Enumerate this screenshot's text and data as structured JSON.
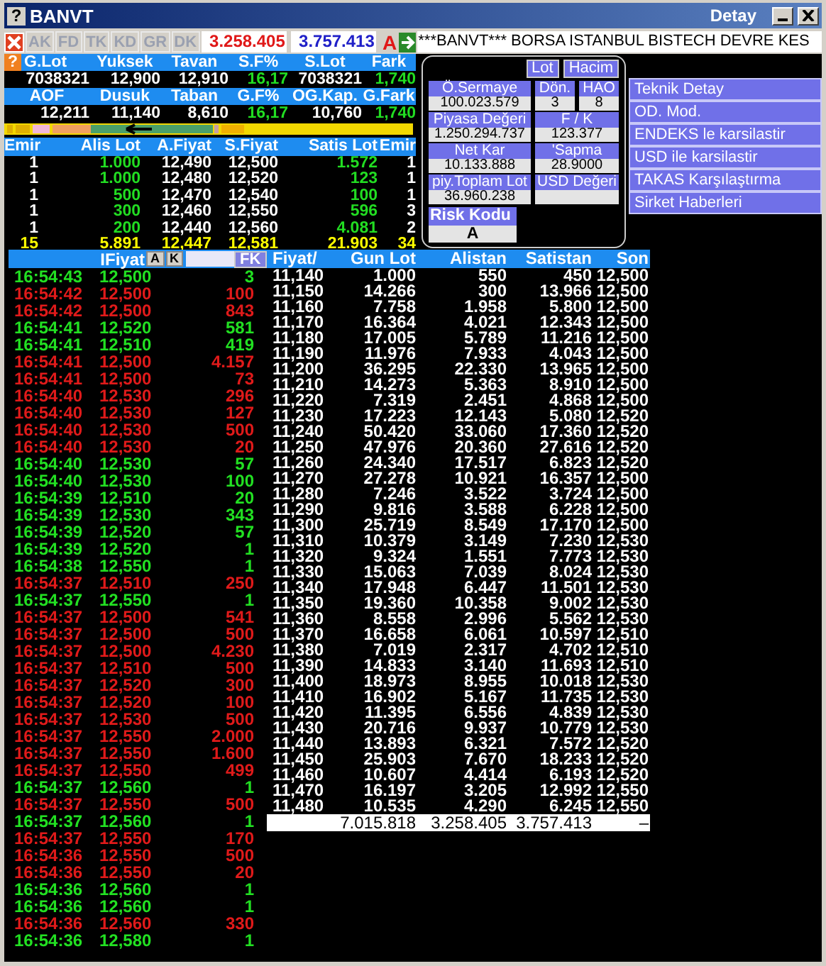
{
  "window": {
    "help": "?",
    "title": "BANVT",
    "detail_title": "Detay"
  },
  "toolbar": {
    "buttons": [
      {
        "label": "AK",
        "disabled": true
      },
      {
        "label": "FD",
        "disabled": true
      },
      {
        "label": "TK",
        "disabled": true
      },
      {
        "label": "KD",
        "disabled": true
      },
      {
        "label": "GR",
        "disabled": true
      },
      {
        "label": "DK",
        "disabled": true
      }
    ],
    "buy_total": "3.258.405",
    "sell_total": "3.757.413",
    "flag": "A"
  },
  "ticker": "***BANVT*** BORSA ISTANBUL BISTECH DEVRE KES",
  "summary": {
    "help": "?",
    "rows": [
      [
        {
          "label": "G.Lot",
          "value": "7038321",
          "positive": false
        },
        {
          "label": "Yuksek",
          "value": "12,900",
          "positive": false
        },
        {
          "label": "Tavan",
          "value": "12,910",
          "positive": false
        },
        {
          "label": "S.F%",
          "value": "16,17",
          "positive": true
        },
        {
          "label": "S.Lot",
          "value": "7038321",
          "positive": false
        },
        {
          "label": "Fark",
          "value": "1,740",
          "positive": true
        }
      ],
      [
        {
          "label": "AOF",
          "value": "12,211",
          "positive": false
        },
        {
          "label": "Dusuk",
          "value": "11,140",
          "positive": false
        },
        {
          "label": "Taban",
          "value": "8,610",
          "positive": false
        },
        {
          "label": "G.F%",
          "value": "16,17",
          "positive": true
        },
        {
          "label": "OG.Kap.",
          "value": "10,760",
          "positive": false
        },
        {
          "label": "G.Fark",
          "value": "1,740",
          "positive": true
        }
      ]
    ]
  },
  "order_book": {
    "columns": [
      "Emir",
      "Alis Lot",
      "A.Fiyat",
      "S.Fiyat",
      "Satis Lot",
      "Emir"
    ],
    "rows": [
      [
        "1",
        "1.000",
        "12,490",
        "12,500",
        "1.572",
        "1"
      ],
      [
        "1",
        "1.000",
        "12,480",
        "12,520",
        "123",
        "1"
      ],
      [
        "1",
        "500",
        "12,470",
        "12,540",
        "100",
        "1"
      ],
      [
        "1",
        "300",
        "12,460",
        "12,550",
        "596",
        "3"
      ],
      [
        "1",
        "200",
        "12,440",
        "12,560",
        "4.081",
        "2"
      ]
    ],
    "totals": [
      "15",
      "5.891",
      "12,447",
      "12,581",
      "21.903",
      "34"
    ]
  },
  "stats_panel": {
    "toggle_buttons": [
      "Lot",
      "Hacim"
    ],
    "field_rows": [
      [
        {
          "label": "Ö.Sermaye",
          "value": "100.023.579"
        },
        {
          "label": "Dön.",
          "value": "3"
        },
        {
          "label": "HAO",
          "value": "8"
        }
      ],
      [
        {
          "label": "Piyasa Değeri",
          "value": "1.250.294.737"
        },
        {
          "label": "F / K",
          "value": "123.377"
        }
      ],
      [
        {
          "label": "Net Kar",
          "value": "10.133.888"
        },
        {
          "label": "'Sapma",
          "value": "28.9000"
        }
      ],
      [
        {
          "label": "piy.Toplam Lot",
          "value": "36.960.238"
        },
        {
          "label": "USD Değeri"
        }
      ]
    ],
    "risk": {
      "label": "Risk Kodu",
      "value": "A"
    }
  },
  "side_buttons": [
    "Teknik Detay",
    "OD. Mod.",
    "ENDEKS le karsilastir",
    "USD ile karsilastir",
    "TAKAS Karşılaştırma",
    "Sirket Haberleri"
  ],
  "trades": {
    "header": "IFiyat",
    "buttons": [
      "A",
      "K"
    ],
    "filter_button": "FK",
    "rows": [
      {
        "time": "16:54:43",
        "price": "12,500",
        "lot": "3",
        "color": "#22e022"
      },
      {
        "time": "16:54:42",
        "price": "12,500",
        "lot": "100",
        "color": "#e01a1a"
      },
      {
        "time": "16:54:42",
        "price": "12,500",
        "lot": "843",
        "color": "#e01a1a"
      },
      {
        "time": "16:54:41",
        "price": "12,520",
        "lot": "581",
        "color": "#22e022"
      },
      {
        "time": "16:54:41",
        "price": "12,510",
        "lot": "419",
        "color": "#22e022"
      },
      {
        "time": "16:54:41",
        "price": "12,500",
        "lot": "4.157",
        "color": "#e01a1a"
      },
      {
        "time": "16:54:41",
        "price": "12,500",
        "lot": "73",
        "color": "#e01a1a"
      },
      {
        "time": "16:54:40",
        "price": "12,530",
        "lot": "296",
        "color": "#e01a1a"
      },
      {
        "time": "16:54:40",
        "price": "12,530",
        "lot": "127",
        "color": "#e01a1a"
      },
      {
        "time": "16:54:40",
        "price": "12,530",
        "lot": "500",
        "color": "#e01a1a"
      },
      {
        "time": "16:54:40",
        "price": "12,530",
        "lot": "20",
        "color": "#e01a1a"
      },
      {
        "time": "16:54:40",
        "price": "12,530",
        "lot": "57",
        "color": "#22e022"
      },
      {
        "time": "16:54:40",
        "price": "12,530",
        "lot": "100",
        "color": "#22e022"
      },
      {
        "time": "16:54:39",
        "price": "12,510",
        "lot": "20",
        "color": "#22e022"
      },
      {
        "time": "16:54:39",
        "price": "12,530",
        "lot": "343",
        "color": "#22e022"
      },
      {
        "time": "16:54:39",
        "price": "12,520",
        "lot": "57",
        "color": "#22e022"
      },
      {
        "time": "16:54:39",
        "price": "12,520",
        "lot": "1",
        "color": "#22e022"
      },
      {
        "time": "16:54:38",
        "price": "12,550",
        "lot": "1",
        "color": "#22e022"
      },
      {
        "time": "16:54:37",
        "price": "12,510",
        "lot": "250",
        "color": "#e01a1a"
      },
      {
        "time": "16:54:37",
        "price": "12,550",
        "lot": "1",
        "color": "#22e022"
      },
      {
        "time": "16:54:37",
        "price": "12,500",
        "lot": "541",
        "color": "#e01a1a"
      },
      {
        "time": "16:54:37",
        "price": "12,500",
        "lot": "500",
        "color": "#e01a1a"
      },
      {
        "time": "16:54:37",
        "price": "12,500",
        "lot": "4.230",
        "color": "#e01a1a"
      },
      {
        "time": "16:54:37",
        "price": "12,510",
        "lot": "500",
        "color": "#e01a1a"
      },
      {
        "time": "16:54:37",
        "price": "12,520",
        "lot": "300",
        "color": "#e01a1a"
      },
      {
        "time": "16:54:37",
        "price": "12,520",
        "lot": "100",
        "color": "#e01a1a"
      },
      {
        "time": "16:54:37",
        "price": "12,530",
        "lot": "500",
        "color": "#e01a1a"
      },
      {
        "time": "16:54:37",
        "price": "12,550",
        "lot": "2.000",
        "color": "#e01a1a"
      },
      {
        "time": "16:54:37",
        "price": "12,550",
        "lot": "1.600",
        "color": "#e01a1a"
      },
      {
        "time": "16:54:37",
        "price": "12,550",
        "lot": "499",
        "color": "#e01a1a"
      },
      {
        "time": "16:54:37",
        "price": "12,560",
        "lot": "1",
        "color": "#22e022"
      },
      {
        "time": "16:54:37",
        "price": "12,550",
        "lot": "500",
        "color": "#e01a1a"
      },
      {
        "time": "16:54:37",
        "price": "12,560",
        "lot": "1",
        "color": "#22e022"
      },
      {
        "time": "16:54:37",
        "price": "12,550",
        "lot": "170",
        "color": "#e01a1a"
      },
      {
        "time": "16:54:36",
        "price": "12,550",
        "lot": "500",
        "color": "#e01a1a"
      },
      {
        "time": "16:54:36",
        "price": "12,550",
        "lot": "20",
        "color": "#e01a1a"
      },
      {
        "time": "16:54:36",
        "price": "12,560",
        "lot": "1",
        "color": "#22e022"
      },
      {
        "time": "16:54:36",
        "price": "12,560",
        "lot": "1",
        "color": "#22e022"
      },
      {
        "time": "16:54:36",
        "price": "12,560",
        "lot": "330",
        "color": "#e01a1a"
      },
      {
        "time": "16:54:36",
        "price": "12,580",
        "lot": "1",
        "color": "#22e022"
      }
    ]
  },
  "price_table": {
    "columns": [
      "Fiyat/",
      "Gun Lot",
      "Alistan",
      "Satistan",
      "Son"
    ],
    "rows": [
      [
        "11,140",
        "1.000",
        "550",
        "450",
        "12,500"
      ],
      [
        "11,150",
        "14.266",
        "300",
        "13.966",
        "12,500"
      ],
      [
        "11,160",
        "7.758",
        "1.958",
        "5.800",
        "12,500"
      ],
      [
        "11,170",
        "16.364",
        "4.021",
        "12.343",
        "12,500"
      ],
      [
        "11,180",
        "17.005",
        "5.789",
        "11.216",
        "12,500"
      ],
      [
        "11,190",
        "11.976",
        "7.933",
        "4.043",
        "12,500"
      ],
      [
        "11,200",
        "36.295",
        "22.330",
        "13.965",
        "12,500"
      ],
      [
        "11,210",
        "14.273",
        "5.363",
        "8.910",
        "12,500"
      ],
      [
        "11,220",
        "7.319",
        "2.451",
        "4.868",
        "12,500"
      ],
      [
        "11,230",
        "17.223",
        "12.143",
        "5.080",
        "12,520"
      ],
      [
        "11,240",
        "50.420",
        "33.060",
        "17.360",
        "12,520"
      ],
      [
        "11,250",
        "47.976",
        "20.360",
        "27.616",
        "12,520"
      ],
      [
        "11,260",
        "24.340",
        "17.517",
        "6.823",
        "12,520"
      ],
      [
        "11,270",
        "27.278",
        "10.921",
        "16.357",
        "12,500"
      ],
      [
        "11,280",
        "7.246",
        "3.522",
        "3.724",
        "12,500"
      ],
      [
        "11,290",
        "9.816",
        "3.588",
        "6.228",
        "12,500"
      ],
      [
        "11,300",
        "25.719",
        "8.549",
        "17.170",
        "12,500"
      ],
      [
        "11,310",
        "10.379",
        "3.149",
        "7.230",
        "12,530"
      ],
      [
        "11,320",
        "9.324",
        "1.551",
        "7.773",
        "12,530"
      ],
      [
        "11,330",
        "15.063",
        "7.039",
        "8.024",
        "12,530"
      ],
      [
        "11,340",
        "17.948",
        "6.447",
        "11.501",
        "12,530"
      ],
      [
        "11,350",
        "19.360",
        "10.358",
        "9.002",
        "12,530"
      ],
      [
        "11,360",
        "8.558",
        "2.996",
        "5.562",
        "12,530"
      ],
      [
        "11,370",
        "16.658",
        "6.061",
        "10.597",
        "12,510"
      ],
      [
        "11,380",
        "7.019",
        "2.317",
        "4.702",
        "12,510"
      ],
      [
        "11,390",
        "14.833",
        "3.140",
        "11.693",
        "12,510"
      ],
      [
        "11,400",
        "18.973",
        "8.955",
        "10.018",
        "12,530"
      ],
      [
        "11,410",
        "16.902",
        "5.167",
        "11.735",
        "12,530"
      ],
      [
        "11,420",
        "11.395",
        "6.556",
        "4.839",
        "12,530"
      ],
      [
        "11,430",
        "20.716",
        "9.937",
        "10.779",
        "12,530"
      ],
      [
        "11,440",
        "13.893",
        "6.321",
        "7.572",
        "12,520"
      ],
      [
        "11,450",
        "25.903",
        "7.670",
        "18.233",
        "12,520"
      ],
      [
        "11,460",
        "10.607",
        "4.414",
        "6.193",
        "12,520"
      ],
      [
        "11,470",
        "16.197",
        "3.205",
        "12.992",
        "12,550"
      ],
      [
        "11,480",
        "10.535",
        "4.290",
        "6.245",
        "12,550"
      ]
    ],
    "totals": [
      "7.015.818",
      "3.258.405",
      "3.757.413",
      "–"
    ]
  }
}
